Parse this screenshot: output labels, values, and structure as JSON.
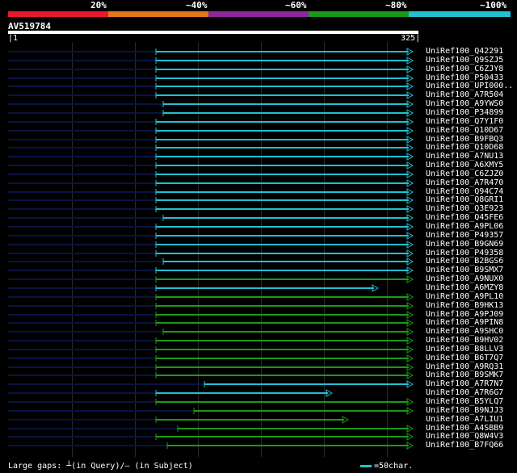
{
  "legend": {
    "labels": [
      "20%",
      "~40%",
      "~60%",
      "~80%",
      "~100%"
    ],
    "colors": [
      "#e8192c",
      "#e07818",
      "#8a2a9a",
      "#1a9a1a",
      "#22c0d0"
    ]
  },
  "query": {
    "name": "AV519784",
    "start": "1",
    "end": "325"
  },
  "footer": {
    "gaps_text": "Large gaps: ┴(in Query)/— (in Subject)",
    "scale_text": "=50char."
  },
  "colors": {
    "cyan": "#22c0d0",
    "green": "#1a9a1a",
    "navy": "#0a1440",
    "grid": "#2a2a2a"
  },
  "hits": [
    {
      "name": "UniRef100_Q42291",
      "color": "cyan"
    },
    {
      "name": "UniRef100_Q9SZJ5",
      "color": "cyan"
    },
    {
      "name": "UniRef100_C6ZJY8",
      "color": "cyan"
    },
    {
      "name": "UniRef100_P50433",
      "color": "cyan"
    },
    {
      "name": "UniRef100_UPI000..",
      "color": "cyan"
    },
    {
      "name": "UniRef100_A7R504",
      "color": "cyan"
    },
    {
      "name": "UniRef100_A9YWS0",
      "color": "cyan"
    },
    {
      "name": "UniRef100_P34899",
      "color": "cyan"
    },
    {
      "name": "UniRef100_Q7Y1F0",
      "color": "cyan"
    },
    {
      "name": "UniRef100_Q10D67",
      "color": "cyan"
    },
    {
      "name": "UniRef100_B9FBQ3",
      "color": "cyan"
    },
    {
      "name": "UniRef100_Q10D68",
      "color": "cyan"
    },
    {
      "name": "UniRef100_A7NU13",
      "color": "cyan"
    },
    {
      "name": "UniRef100_A6XMY5",
      "color": "cyan"
    },
    {
      "name": "UniRef100_C6ZJZ0",
      "color": "cyan"
    },
    {
      "name": "UniRef100_A7R470",
      "color": "cyan"
    },
    {
      "name": "UniRef100_Q94C74",
      "color": "cyan"
    },
    {
      "name": "UniRef100_Q8GRI1",
      "color": "cyan"
    },
    {
      "name": "UniRef100_Q3E923",
      "color": "cyan"
    },
    {
      "name": "UniRef100_Q45FE6",
      "color": "cyan"
    },
    {
      "name": "UniRef100_A9PL06",
      "color": "cyan"
    },
    {
      "name": "UniRef100_P49357",
      "color": "cyan"
    },
    {
      "name": "UniRef100_B9GN69",
      "color": "cyan"
    },
    {
      "name": "UniRef100_P49358",
      "color": "cyan"
    },
    {
      "name": "UniRef100_B2BGS6",
      "color": "cyan"
    },
    {
      "name": "UniRef100_B9SMX7",
      "color": "cyan"
    },
    {
      "name": "UniRef100_A9NUX0",
      "color": "green"
    },
    {
      "name": "UniRef100_A6MZY8",
      "color": "cyan"
    },
    {
      "name": "UniRef100_A9PL10",
      "color": "green"
    },
    {
      "name": "UniRef100_B9HK13",
      "color": "green"
    },
    {
      "name": "UniRef100_A9PJ09",
      "color": "green"
    },
    {
      "name": "UniRef100_A9PIN8",
      "color": "green"
    },
    {
      "name": "UniRef100_A9SHC0",
      "color": "green"
    },
    {
      "name": "UniRef100_B9HV02",
      "color": "green"
    },
    {
      "name": "UniRef100_B8LLV3",
      "color": "green"
    },
    {
      "name": "UniRef100_B6T7Q7",
      "color": "green"
    },
    {
      "name": "UniRef100_A9RQ31",
      "color": "green"
    },
    {
      "name": "UniRef100_B9SMK7",
      "color": "green"
    },
    {
      "name": "UniRef100_A7R7N7",
      "color": "cyan"
    },
    {
      "name": "UniRef100_A7R6G7",
      "color": "cyan"
    },
    {
      "name": "UniRef100_B5YLQ7",
      "color": "green"
    },
    {
      "name": "UniRef100_B9NJJ3",
      "color": "green"
    },
    {
      "name": "UniRef100_A7LIU1",
      "color": "green"
    },
    {
      "name": "UniRef100_A4SBB9",
      "color": "green"
    },
    {
      "name": "UniRef100_Q8W4V3",
      "color": "green"
    },
    {
      "name": "UniRef100_B7FQ66",
      "color": "green"
    }
  ]
}
